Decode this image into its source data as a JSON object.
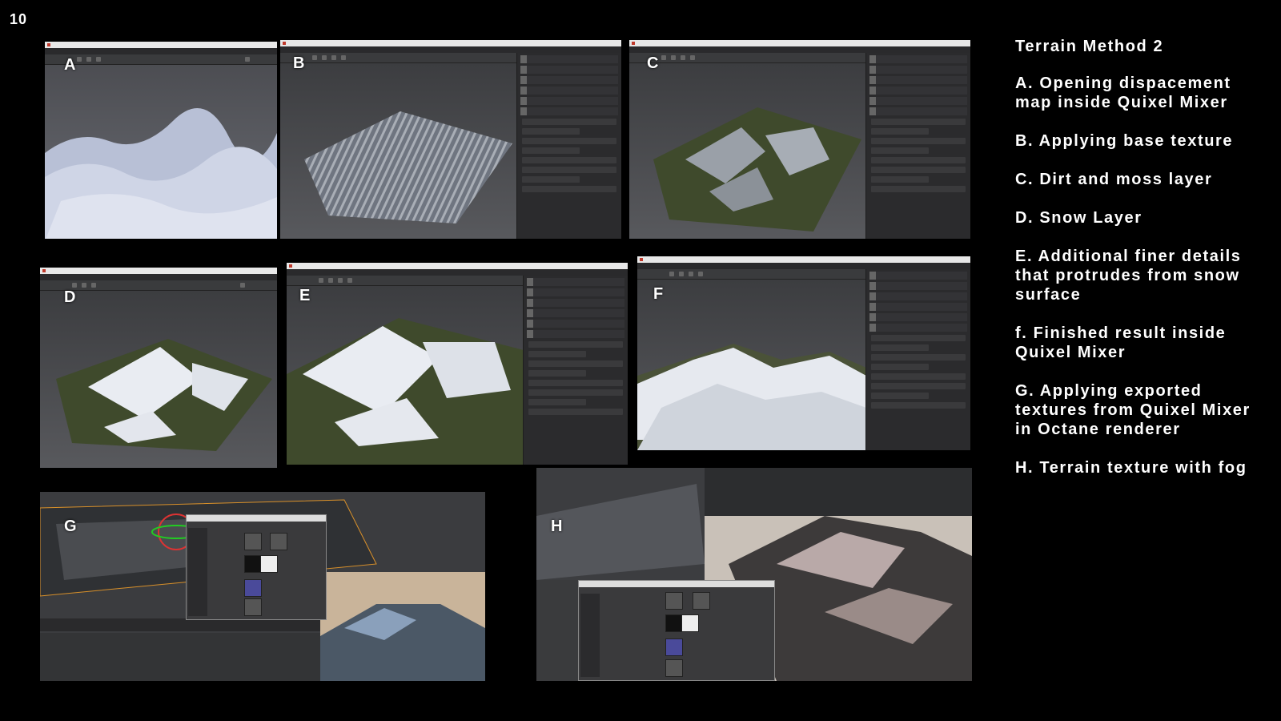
{
  "page_number": "10",
  "panels": {
    "A": {
      "label": "A"
    },
    "B": {
      "label": "B"
    },
    "C": {
      "label": "C"
    },
    "D": {
      "label": "D"
    },
    "E": {
      "label": "E"
    },
    "F": {
      "label": "F"
    },
    "G": {
      "label": "G"
    },
    "H": {
      "label": "H"
    }
  },
  "captions": {
    "title": "Terrain Method 2",
    "items": [
      "A. Opening dispacement map inside Quixel Mixer",
      "B. Applying base texture",
      "C. Dirt and moss layer",
      "D. Snow Layer",
      "E. Additional finer details that protrudes from snow surface",
      "f. Finished result inside Quixel Mixer",
      "G. Applying exported textures from Quixel Mixer in Octane renderer",
      "H. Terrain texture with fog"
    ]
  },
  "colors": {
    "background": "#000000",
    "app_chrome": "#2f3032",
    "snow": "#e9ecf2",
    "rock": "#6c6f74",
    "moss": "#3f4a2c",
    "accent_red": "#c0392b"
  }
}
